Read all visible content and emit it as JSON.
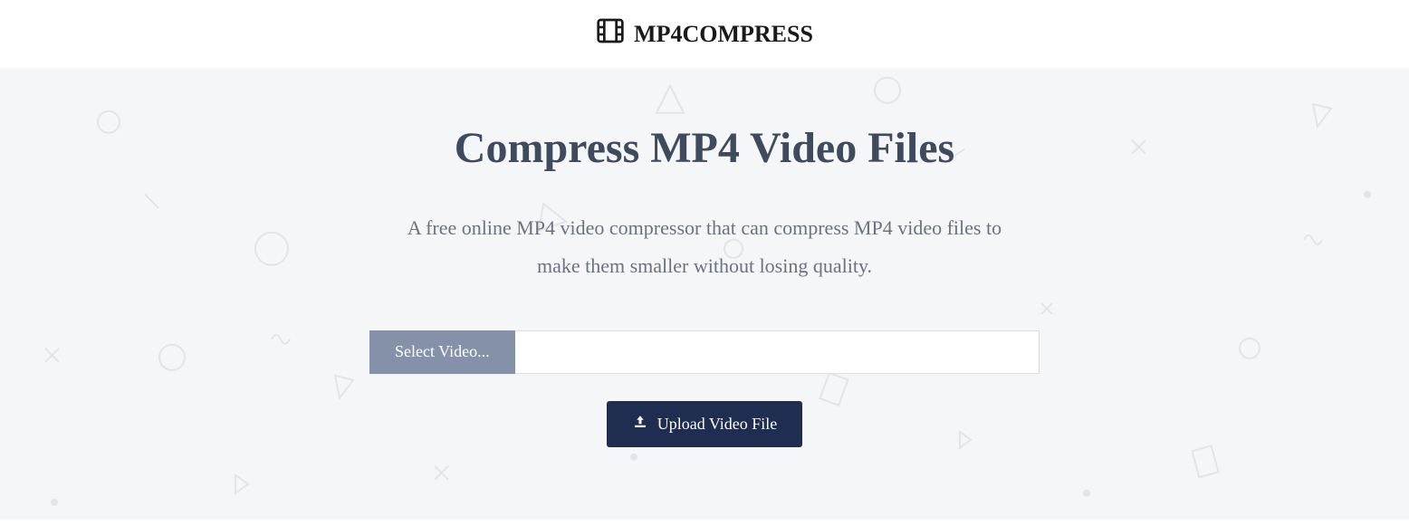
{
  "header": {
    "brand": "MP4COMPRESS"
  },
  "hero": {
    "title": "Compress MP4 Video Files",
    "subtitle": "A free online MP4 video compressor that can compress MP4 video files to make them smaller without losing quality.",
    "select_label": "Select Video...",
    "file_value": "",
    "upload_label": "Upload Video File"
  }
}
